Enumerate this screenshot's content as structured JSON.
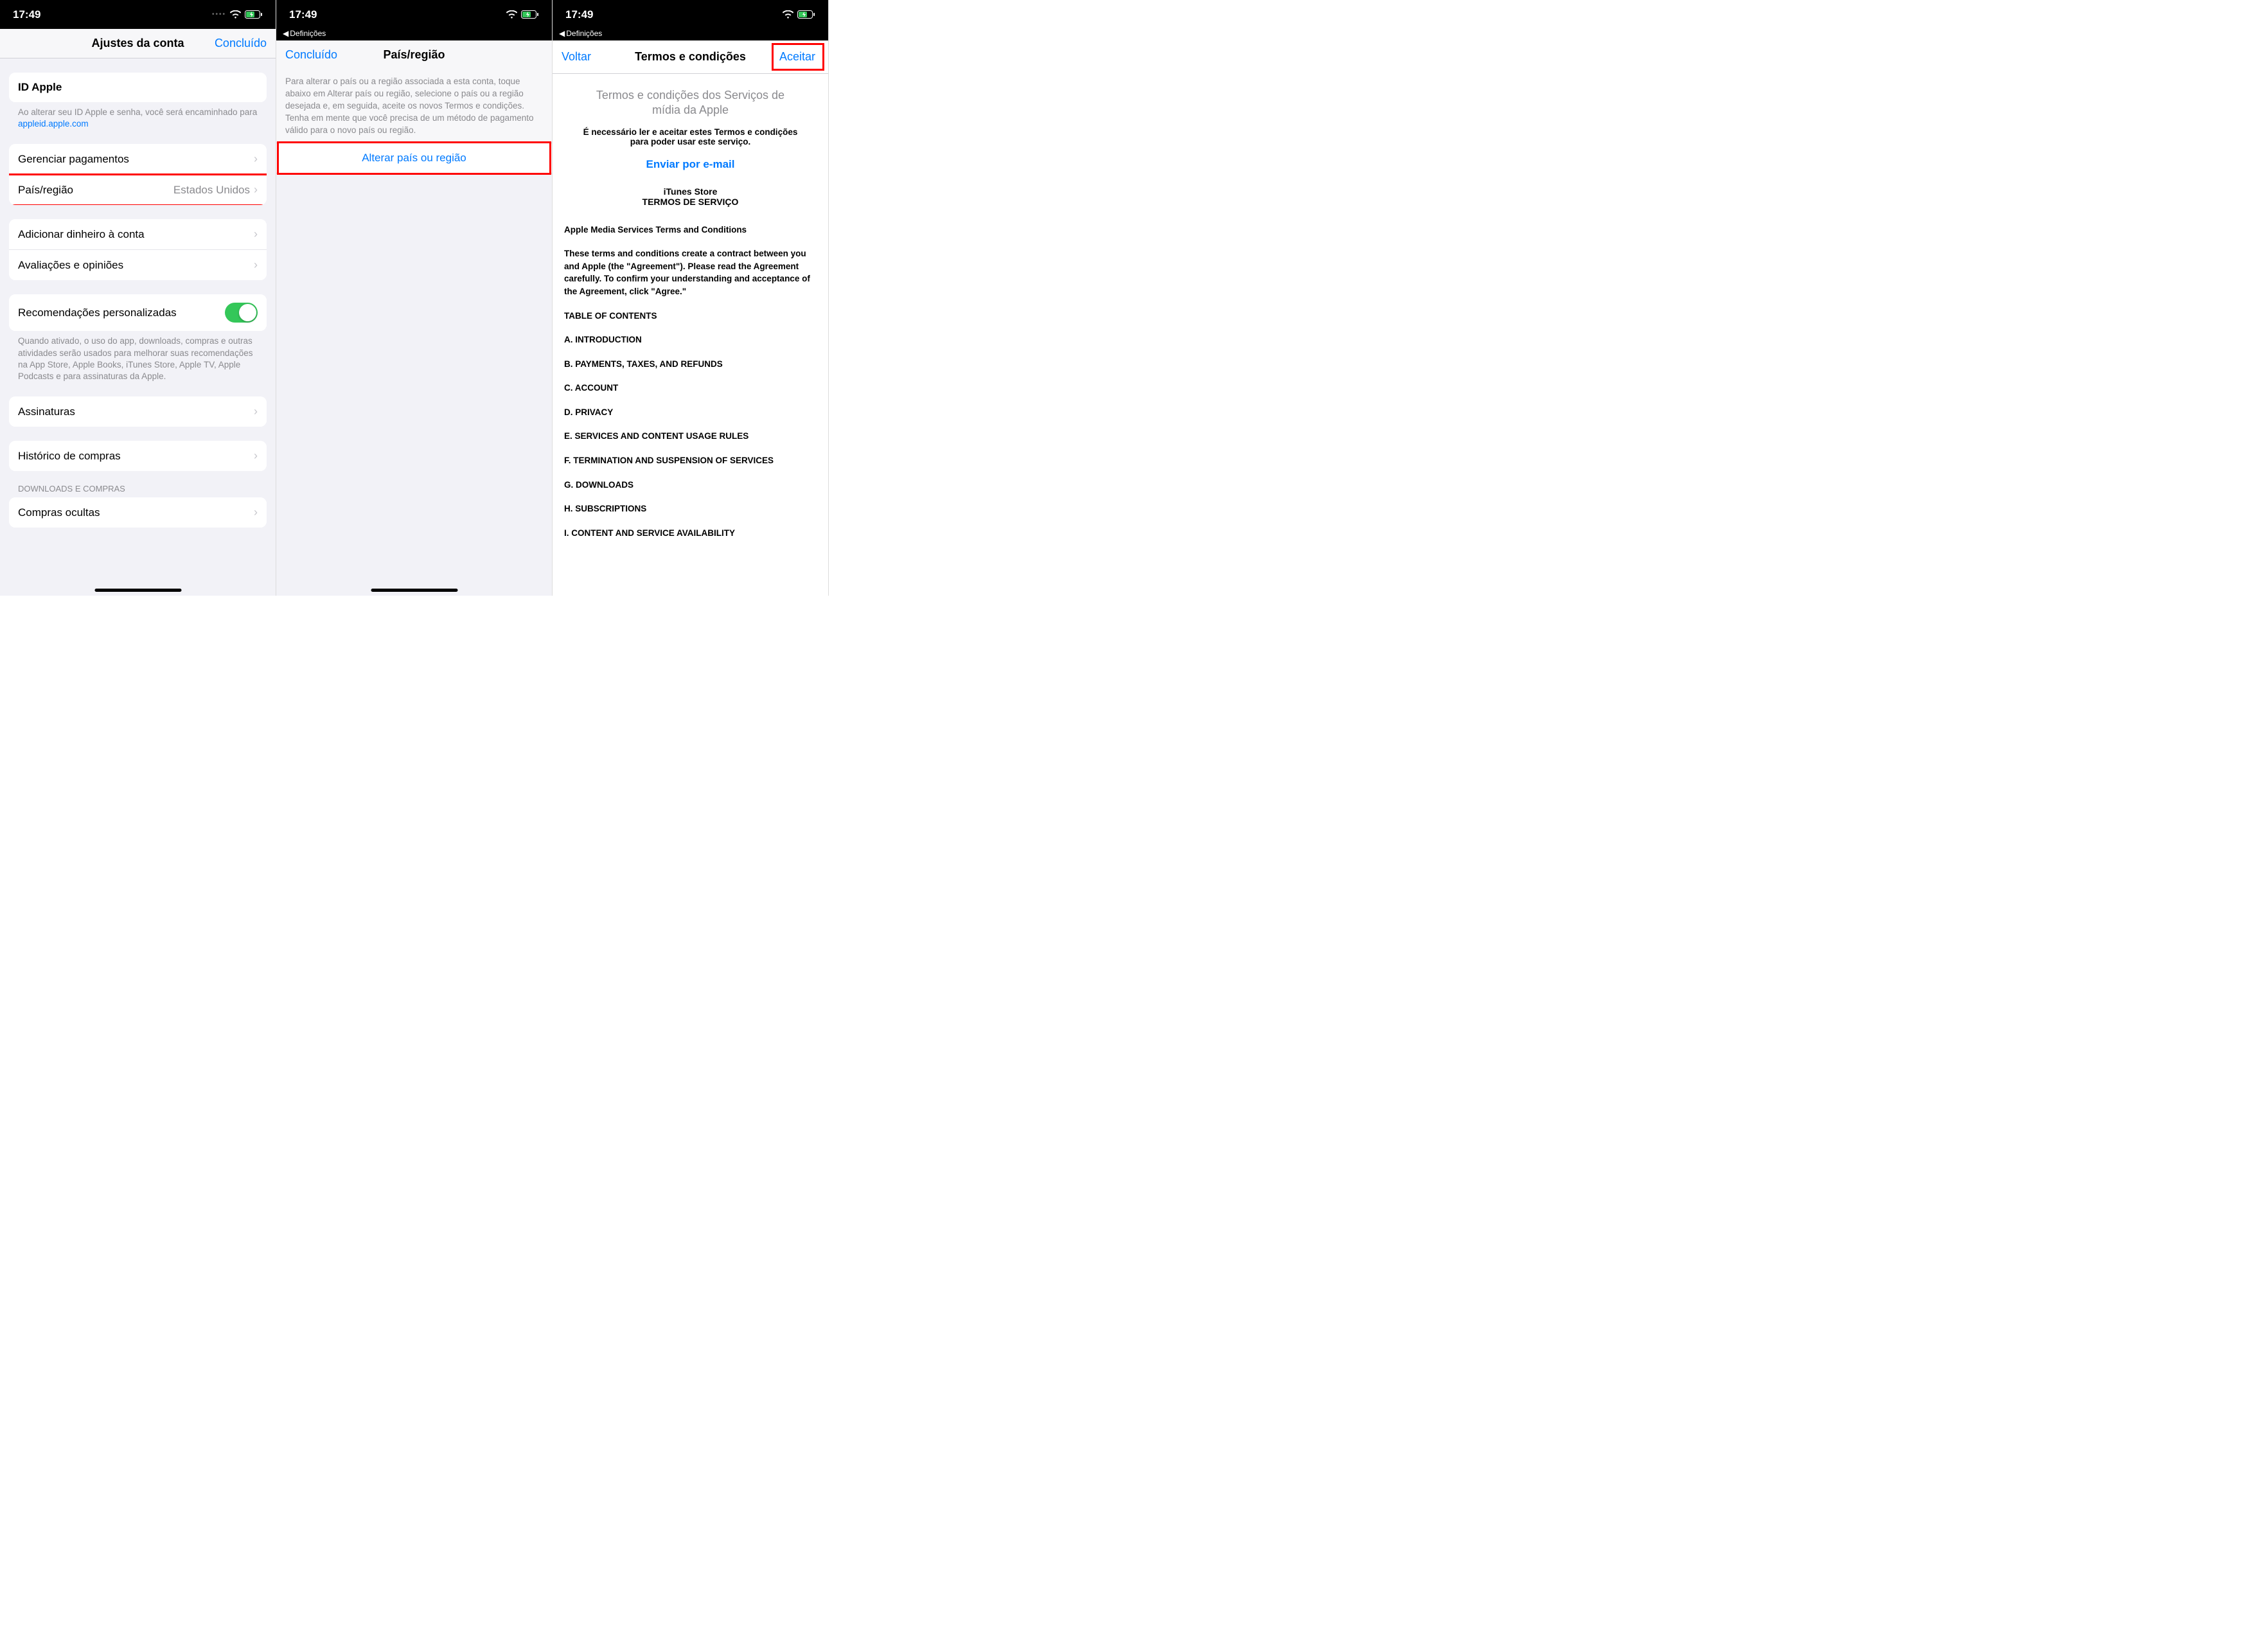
{
  "status": {
    "time": "17:49",
    "back_label": "Definições"
  },
  "screen1": {
    "nav": {
      "title": "Ajustes da conta",
      "done": "Concluído"
    },
    "apple_id": {
      "label": "ID Apple",
      "footer_a": "Ao alterar seu ID Apple e senha, você será encaminhado para ",
      "footer_link": "appleid.apple.com"
    },
    "rows": {
      "payments": "Gerenciar pagamentos",
      "country": "País/região",
      "country_value": "Estados Unidos",
      "add_funds": "Adicionar dinheiro à conta",
      "ratings": "Avaliações e opiniões"
    },
    "personalized": {
      "label": "Recomendações personalizadas",
      "footer": "Quando ativado, o uso do app, downloads, compras e outras atividades serão usados para melhorar suas recomendações na App Store, Apple Books, iTunes Store, Apple TV, Apple Podcasts e para assinaturas da Apple."
    },
    "subs": "Assinaturas",
    "history": "Histórico de compras",
    "downloads_header": "DOWNLOADS E COMPRAS",
    "hidden": "Compras ocultas"
  },
  "screen2": {
    "nav": {
      "done": "Concluído",
      "title": "País/região"
    },
    "info": "Para alterar o país ou a região associada a esta conta, toque abaixo em Alterar país ou região, selecione o país ou a região desejada e, em seguida, aceite os novos Termos e condições. Tenha em mente que você precisa de um método de pagamento válido para o novo país ou região.",
    "action": "Alterar país ou região"
  },
  "screen3": {
    "nav": {
      "back": "Voltar",
      "title": "Termos e condições",
      "accept": "Aceitar"
    },
    "heading": "Termos e condições dos Serviços de mídia da Apple",
    "sub": "É necessário ler e aceitar estes Termos e condições para poder usar este serviço.",
    "email": "Enviar por e-mail",
    "store": "iTunes Store",
    "svc": "TERMOS DE SERVIÇO",
    "p1": "Apple Media Services Terms and Conditions",
    "p2": "These terms and conditions create a contract between you and Apple (the \"Agreement\"). Please read the Agreement carefully. To confirm your understanding and acceptance of the Agreement, click \"Agree.\"",
    "toc": "TABLE OF CONTENTS",
    "items": {
      "a": "A. INTRODUCTION",
      "b": "B. PAYMENTS, TAXES, AND REFUNDS",
      "c": "C. ACCOUNT",
      "d": "D. PRIVACY",
      "e": "E. SERVICES AND CONTENT USAGE RULES",
      "f": "F. TERMINATION AND SUSPENSION OF SERVICES",
      "g": "G. DOWNLOADS",
      "h": "H. SUBSCRIPTIONS",
      "i": "I. CONTENT AND SERVICE AVAILABILITY"
    }
  }
}
